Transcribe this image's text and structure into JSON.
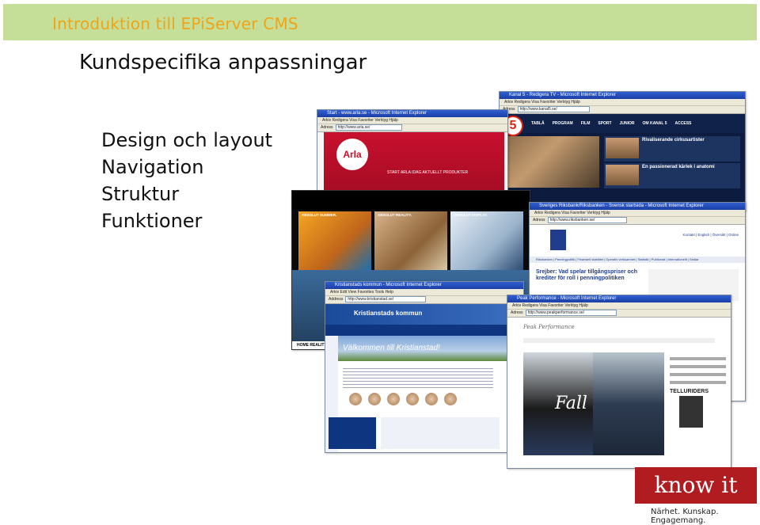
{
  "header": {
    "title": "Introduktion till EPiServer CMS"
  },
  "page_title": "Kundspecifika anpassningar",
  "bullets": [
    "Design och layout",
    "Navigation",
    "Struktur",
    "Funktioner"
  ],
  "screenshots": {
    "kanal5": {
      "window_title": "Kanal 5 - Redigera TV - Microsoft Internet Explorer",
      "menu": "Arkiv  Redigera  Visa  Favoriter  Verktyg  Hjälp",
      "address_label": "Adress",
      "address": "http://www.kanal5.se/",
      "logo": "5",
      "nav": [
        "TABLÅ",
        "PROGRAM",
        "FILM",
        "SPORT",
        "JUNIOR",
        "OM KANAL 5",
        "ACCESS"
      ],
      "headline1": "Rivaliserande cirkusartister",
      "headline2": "En passionerad kärlek i anatomi"
    },
    "arla": {
      "window_title": "Start - www.arla.se - Microsoft Internet Explorer",
      "menu": "Arkiv  Redigera  Visa  Favoriter  Verktyg  Hjälp",
      "address_label": "Adress",
      "address": "http://www.arla.se/",
      "logo": "Arla",
      "menu_items": "START   ARLA IDAG   AKTUELLT   PRODUKTER"
    },
    "absolut": {
      "labels": [
        "ABSOLUT SUMMER.",
        "ABSOLUT REALITY.",
        "ABSOLUT DISPLAY."
      ],
      "footer": "HOME   REALITY   COLL"
    },
    "riksbanken": {
      "window_title": "Sveriges Riksbank/Riksbanken - Svensk startsida - Microsoft Internet Explorer",
      "menu": "Arkiv  Redigera  Visa  Favoriter  Verktyg  Hjälp",
      "address_label": "Adress",
      "address": "http://www.riksbanken.se/",
      "links": "Kontakt | English | Översikt | Online",
      "nav": "Riksbanken | Penningpolitik | Finansiell stabilitet | Operativ verksamhet | Statistik | Publicerat | Internationellt | Sedlar",
      "headline": "Srejber: Vad spelar tillgångspriser och krediter för roll i penningpolitiken"
    },
    "kristianstad": {
      "window_title": "Kristianstads kommun - Microsoft Internet Explorer",
      "menu": "Arkiv  Edit  View  Favorites  Tools  Help",
      "address_label": "Address",
      "address": "http://www.kristianstad.se/",
      "brand": "Kristianstads kommun",
      "welcome": "Välkommen till Kristianstad!"
    },
    "peak": {
      "window_title": "Peak Performance - Microsoft Internet Explorer",
      "menu": "Arkiv  Redigera  Visa  Favoriter  Verktyg  Hjälp",
      "address_label": "Adress",
      "address": "http://www.peakperformance.se/",
      "brand": "Peak Performance",
      "fall": "Fall",
      "side_heading": "TELLURIDERS"
    }
  },
  "logo": {
    "text": "know it",
    "tagline": "Närhet. Kunskap. Engagemang."
  },
  "colors": {
    "header_bg": "#c6df98",
    "header_text": "#f0a418",
    "logo_bg": "#b11c21"
  }
}
